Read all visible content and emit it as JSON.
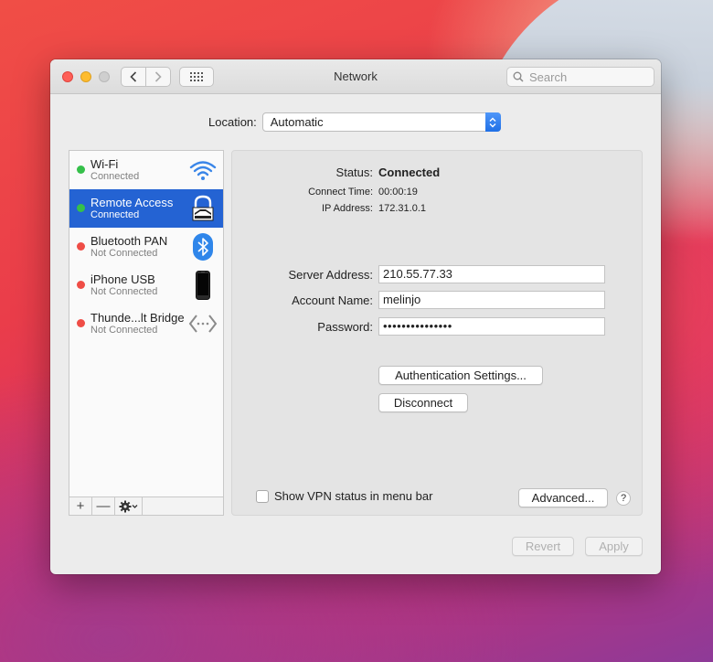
{
  "window": {
    "title": "Network"
  },
  "toolbar": {
    "search_placeholder": "Search"
  },
  "location": {
    "label": "Location:",
    "value": "Automatic"
  },
  "services": [
    {
      "name": "Wi-Fi",
      "status": "Connected",
      "status_color": "green",
      "icon": "wifi-icon",
      "selected": false
    },
    {
      "name": "Remote Access",
      "status": "Connected",
      "status_color": "green",
      "icon": "lock-icon",
      "selected": true
    },
    {
      "name": "Bluetooth PAN",
      "status": "Not Connected",
      "status_color": "red",
      "icon": "bluetooth-icon",
      "selected": false
    },
    {
      "name": "iPhone USB",
      "status": "Not Connected",
      "status_color": "red",
      "icon": "iphone-icon",
      "selected": false
    },
    {
      "name": "Thunde...lt Bridge",
      "status": "Not Connected",
      "status_color": "red",
      "icon": "thunderbolt-bridge-icon",
      "selected": false
    }
  ],
  "sidebar_tools": {
    "add": "+",
    "remove": "—"
  },
  "detail": {
    "status_label": "Status:",
    "status_value": "Connected",
    "connect_time_label": "Connect Time:",
    "connect_time_value": "00:00:19",
    "ip_label": "IP Address:",
    "ip_value": "172.31.0.1",
    "server_label": "Server Address:",
    "server_value": "210.55.77.33",
    "account_label": "Account Name:",
    "account_value": "melinjo",
    "password_label": "Password:",
    "password_value": "•••••••••••••••",
    "auth_button": "Authentication Settings...",
    "disconnect_button": "Disconnect",
    "vpn_checkbox_label": "Show VPN status in menu bar",
    "advanced_button": "Advanced...",
    "help": "?"
  },
  "footer": {
    "revert": "Revert",
    "apply": "Apply"
  },
  "colors": {
    "accent": "#2463d3",
    "connected": "#35c04a",
    "not_connected": "#ef4d46"
  }
}
